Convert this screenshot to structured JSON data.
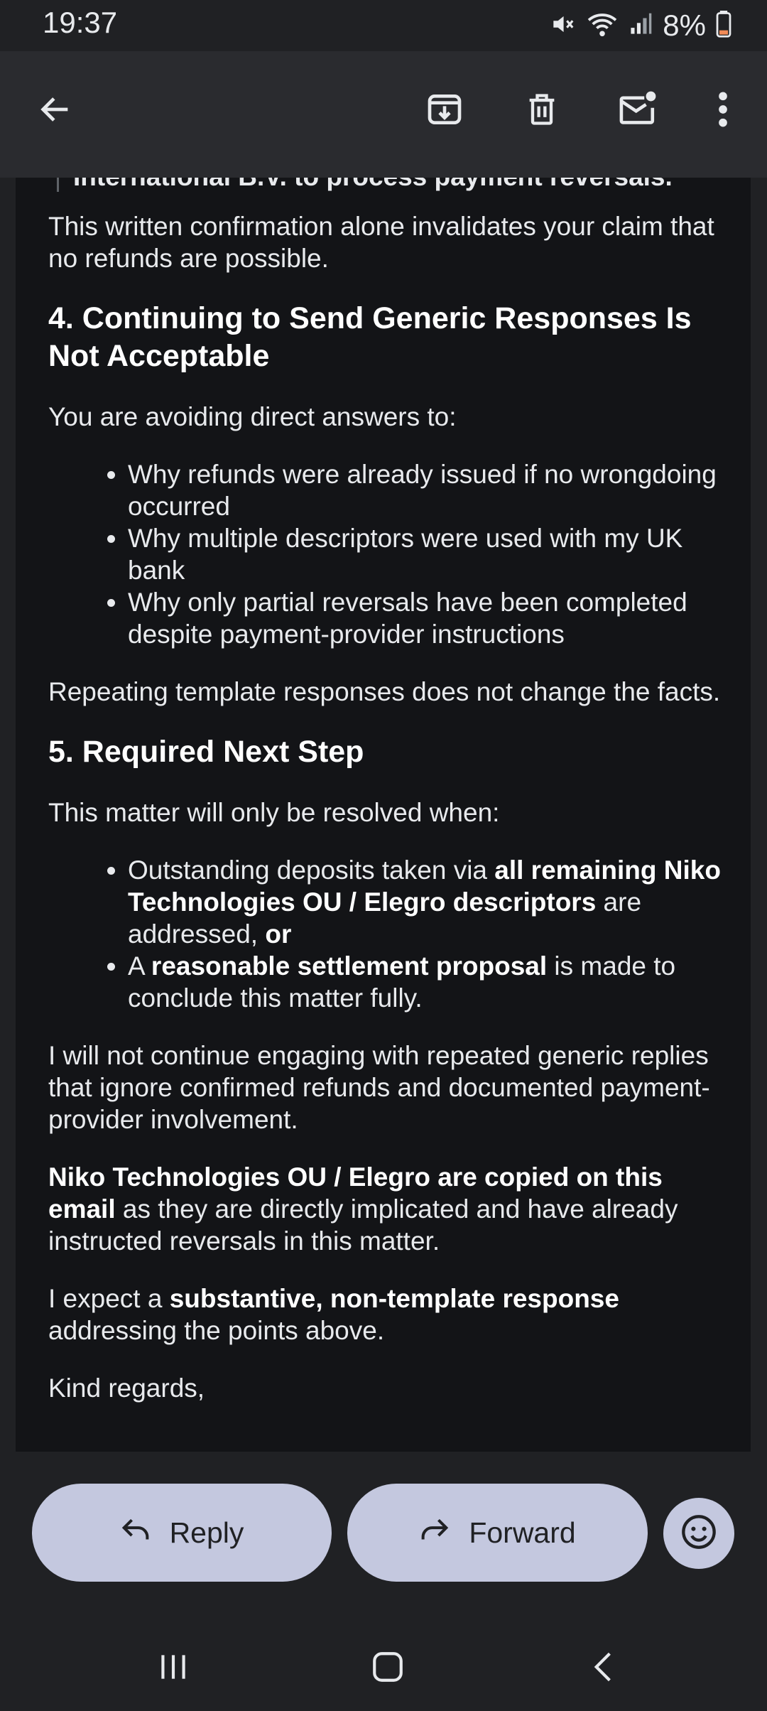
{
  "status_bar": {
    "time": "19:37",
    "battery": "8%",
    "battery_color": "#f28b58"
  },
  "colors": {
    "background": "#202124",
    "app_bar": "#2a2b2f",
    "email_body": "#131417",
    "pill": "#c4c8df"
  },
  "app_bar": {
    "icons": [
      "arrow-back-icon",
      "archive-icon",
      "delete-icon",
      "mark-unread-icon",
      "more-vert-icon"
    ]
  },
  "email": {
    "cut_off_line": "International B.V. to process payment reversals.",
    "p1": "This written confirmation alone invalidates your claim that no refunds are possible.",
    "section4": {
      "heading": "4. Continuing to Send Generic Responses Is Not Acceptable",
      "intro": "You are avoiding direct answers to:",
      "bullets": [
        "Why refunds were already issued if no wrongdoing occurred",
        "Why multiple descriptors were used with my UK bank",
        "Why only partial reversals have been completed despite payment-provider instructions"
      ],
      "outro": "Repeating template responses does not change the facts."
    },
    "section5": {
      "heading": "5. Required Next Step",
      "intro": "This matter will only be resolved when:",
      "bullet1": {
        "a": "Outstanding deposits taken via ",
        "b": "all remaining Niko Technologies OU / Elegro descriptors",
        "c": " are addressed, ",
        "d": "or"
      },
      "bullet2": {
        "a": "A ",
        "b": "reasonable settlement proposal",
        "c": " is made to conclude this matter fully."
      }
    },
    "p_not_continue": "I will not continue engaging with repeated generic replies that ignore confirmed refunds and documented payment-provider involvement.",
    "p_copied": {
      "bold": "Niko Technologies OU / Elegro are copied on this email",
      "rest": " as they are directly implicated and have already instructed reversals in this matter."
    },
    "p_expect": {
      "a": "I expect a ",
      "bold": "substantive, non-template response",
      "c": " addressing the points above."
    },
    "signoff": "Kind regards,"
  },
  "actions": {
    "reply_label": "Reply",
    "forward_label": "Forward"
  },
  "nav": {
    "icons": [
      "recents-icon",
      "home-icon",
      "back-icon"
    ]
  }
}
